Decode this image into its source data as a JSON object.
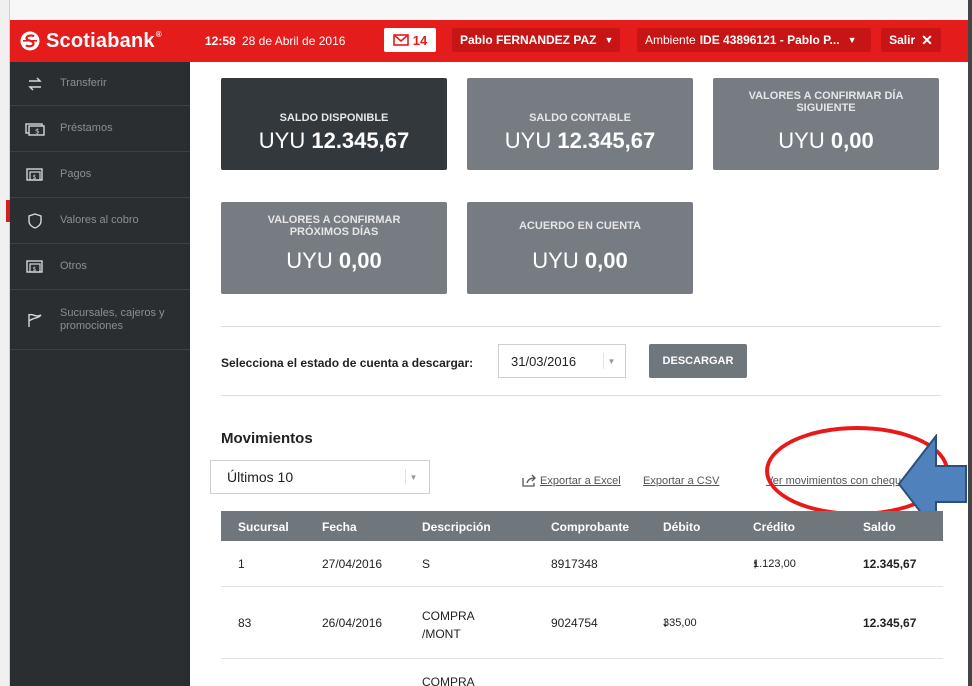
{
  "header": {
    "brand": "Scotiabank",
    "brand_mark": "®",
    "time": "12:58",
    "date": "28 de Abril de 2016",
    "messages_count": "14",
    "user_name": "Pablo FERNANDEZ PAZ",
    "environment_prefix": "Ambiente",
    "environment_value": "IDE 43896121 - Pablo P...",
    "logout_label": "Salir",
    "colors": {
      "brand_red": "#e41c1c",
      "brand_red_dark": "#c71515"
    }
  },
  "sidebar": {
    "items": [
      {
        "label": "Transferir",
        "icon": "transfer-arrows-icon"
      },
      {
        "label": "Préstamos",
        "icon": "loan-money-icon"
      },
      {
        "label": "Pagos",
        "icon": "bill-payment-icon"
      },
      {
        "label": "Valores al cobro",
        "icon": "shield-icon"
      },
      {
        "label": "Otros",
        "icon": "money-bill-icon"
      },
      {
        "label": "Sucursales, cajeros y promociones",
        "icon": "flag-icon"
      }
    ]
  },
  "balances": [
    {
      "title": "SALDO DISPONIBLE",
      "currency": "UYU",
      "amount": "12.345,67",
      "dark": true
    },
    {
      "title": "SALDO CONTABLE",
      "currency": "UYU",
      "amount": "12.345,67",
      "dark": false
    },
    {
      "title": "VALORES A CONFIRMAR DÍA SIGUIENTE",
      "currency": "UYU",
      "amount": "0,00",
      "dark": false
    },
    {
      "title": "VALORES A CONFIRMAR PRÓXIMOS DÍAS",
      "currency": "UYU",
      "amount": "0,00",
      "dark": false
    },
    {
      "title": "ACUERDO EN CUENTA",
      "currency": "UYU",
      "amount": "0,00",
      "dark": false
    }
  ],
  "statement": {
    "label": "Selecciona el estado de cuenta a descargar:",
    "selected_date": "31/03/2016",
    "download_label": "DESCARGAR"
  },
  "movements": {
    "title": "Movimientos",
    "range_selected": "Últimos 10",
    "export_excel": "Exportar a Excel",
    "export_csv": "Exportar a CSV",
    "view_cheques": "Ver movimientos con cheques",
    "columns": [
      "Sucursal",
      "Fecha",
      "Descripción",
      "Comprobante",
      "Débito",
      "Crédito",
      "Saldo"
    ],
    "rows": [
      {
        "sucursal": "1",
        "fecha": "27/04/2016",
        "descripcion": "S",
        "comprobante": "8917348",
        "debito": "",
        "credito": "1.123,00",
        "saldo": "12.345,67"
      },
      {
        "sucursal": "83",
        "fecha": "26/04/2016",
        "descripcion": "COMPRA /MONT",
        "comprobante": "9024754",
        "debito": "335,00",
        "credito": "",
        "saldo": "12.345,67"
      },
      {
        "sucursal": "",
        "fecha": "",
        "descripcion": "COMPRA",
        "comprobante": "",
        "debito": "",
        "credito": "",
        "saldo": ""
      }
    ]
  }
}
